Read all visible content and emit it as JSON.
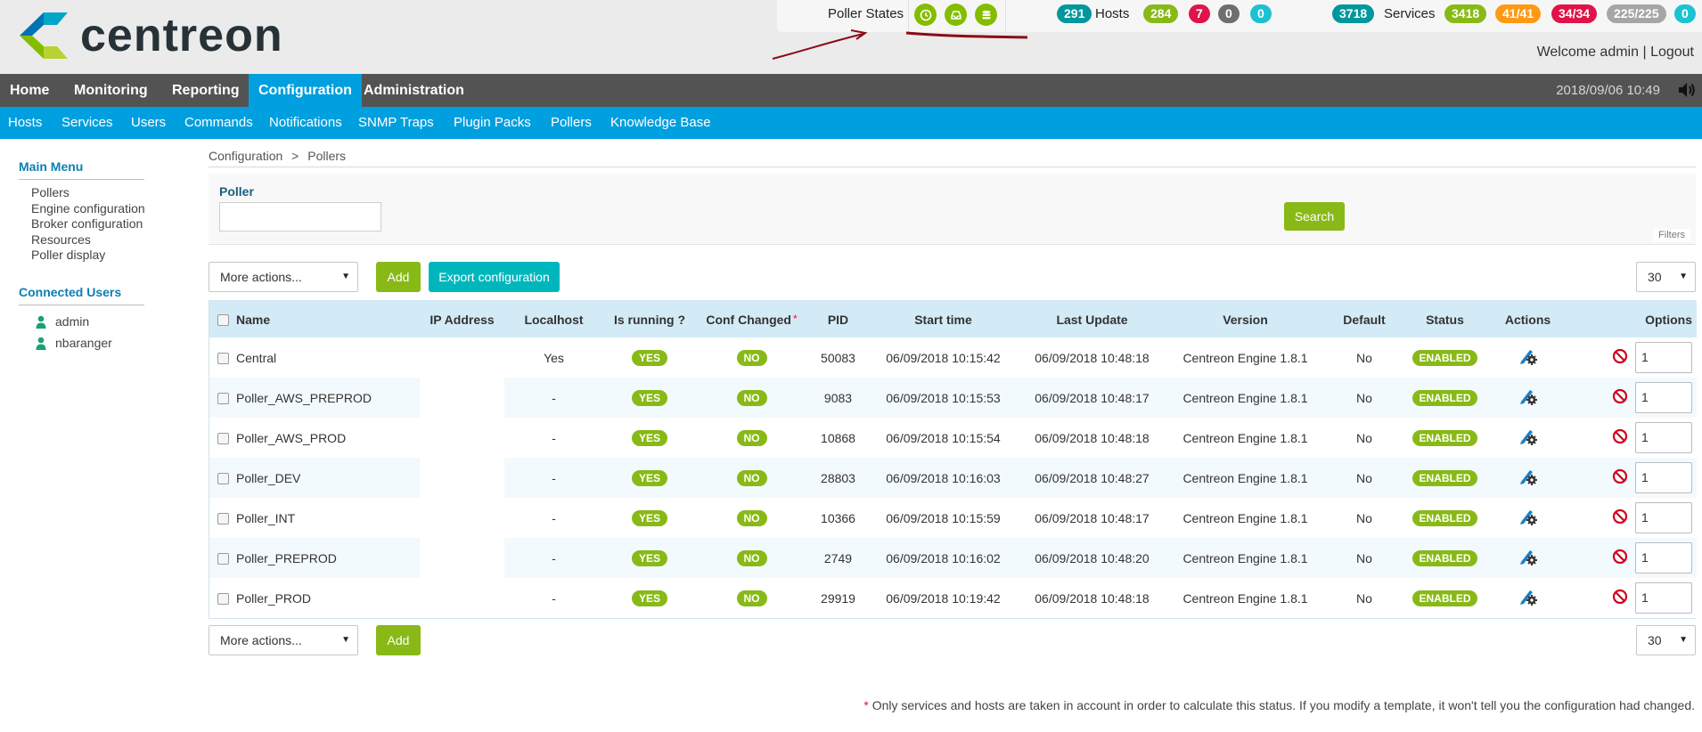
{
  "brand": {
    "name": "centreon"
  },
  "topbar": {
    "poller_states_label": "Poller States",
    "hosts": {
      "total": "291",
      "label": "Hosts",
      "up": "284",
      "down": "7",
      "unreachable": "0",
      "pending": "0"
    },
    "services": {
      "total": "3718",
      "label": "Services",
      "ok": "3418",
      "warning": "41/41",
      "critical": "34/34",
      "unknown": "225/225",
      "pending": "0"
    }
  },
  "user": {
    "welcome": "Welcome admin",
    "separator": "|",
    "logout": "Logout"
  },
  "main_nav": {
    "items": [
      "Home",
      "Monitoring",
      "Reporting",
      "Configuration",
      "Administration"
    ],
    "active": "Configuration",
    "datetime": "2018/09/06 10:49"
  },
  "sub_nav": {
    "items": [
      "Hosts",
      "Services",
      "Users",
      "Commands",
      "Notifications",
      "SNMP Traps",
      "Plugin Packs",
      "Pollers",
      "Knowledge Base"
    ]
  },
  "sidebar": {
    "main_menu_title": "Main Menu",
    "main_menu_items": [
      "Pollers",
      "Engine configuration",
      "Broker configuration",
      "Resources",
      "Poller display"
    ],
    "connected_users_title": "Connected Users",
    "connected_users": [
      "admin",
      "nbaranger"
    ]
  },
  "breadcrumb": {
    "parent": "Configuration",
    "separator": ">",
    "current": "Pollers"
  },
  "filter": {
    "label": "Poller",
    "value": "",
    "search_button": "Search",
    "filters_tag": "Filters"
  },
  "toolbar": {
    "more_actions": "More actions...",
    "add": "Add",
    "export": "Export configuration",
    "page_size": "30"
  },
  "table": {
    "columns": [
      "Name",
      "IP Address",
      "Localhost",
      "Is running ?",
      "Conf Changed",
      "PID",
      "Start time",
      "Last Update",
      "Version",
      "Default",
      "Status",
      "Actions",
      "Options"
    ],
    "conf_changed_marker": "*",
    "rows": [
      {
        "name": "Central",
        "ip": "",
        "localhost": "Yes",
        "running": "YES",
        "conf_changed": "NO",
        "pid": "50083",
        "start": "06/09/2018 10:15:42",
        "last_update": "06/09/2018 10:48:18",
        "version": "Centreon Engine 1.8.1",
        "default": "No",
        "status": "ENABLED",
        "option": "1"
      },
      {
        "name": "Poller_AWS_PREPROD",
        "ip": "",
        "localhost": "-",
        "running": "YES",
        "conf_changed": "NO",
        "pid": "9083",
        "start": "06/09/2018 10:15:53",
        "last_update": "06/09/2018 10:48:17",
        "version": "Centreon Engine 1.8.1",
        "default": "No",
        "status": "ENABLED",
        "option": "1"
      },
      {
        "name": "Poller_AWS_PROD",
        "ip": "",
        "localhost": "-",
        "running": "YES",
        "conf_changed": "NO",
        "pid": "10868",
        "start": "06/09/2018 10:15:54",
        "last_update": "06/09/2018 10:48:18",
        "version": "Centreon Engine 1.8.1",
        "default": "No",
        "status": "ENABLED",
        "option": "1"
      },
      {
        "name": "Poller_DEV",
        "ip": "",
        "localhost": "-",
        "running": "YES",
        "conf_changed": "NO",
        "pid": "28803",
        "start": "06/09/2018 10:16:03",
        "last_update": "06/09/2018 10:48:27",
        "version": "Centreon Engine 1.8.1",
        "default": "No",
        "status": "ENABLED",
        "option": "1"
      },
      {
        "name": "Poller_INT",
        "ip": "",
        "localhost": "-",
        "running": "YES",
        "conf_changed": "NO",
        "pid": "10366",
        "start": "06/09/2018 10:15:59",
        "last_update": "06/09/2018 10:48:17",
        "version": "Centreon Engine 1.8.1",
        "default": "No",
        "status": "ENABLED",
        "option": "1"
      },
      {
        "name": "Poller_PREPROD",
        "ip": "",
        "localhost": "-",
        "running": "YES",
        "conf_changed": "NO",
        "pid": "2749",
        "start": "06/09/2018 10:16:02",
        "last_update": "06/09/2018 10:48:20",
        "version": "Centreon Engine 1.8.1",
        "default": "No",
        "status": "ENABLED",
        "option": "1"
      },
      {
        "name": "Poller_PROD",
        "ip": "",
        "localhost": "-",
        "running": "YES",
        "conf_changed": "NO",
        "pid": "29919",
        "start": "06/09/2018 10:19:42",
        "last_update": "06/09/2018 10:48:18",
        "version": "Centreon Engine 1.8.1",
        "default": "No",
        "status": "ENABLED",
        "option": "1"
      }
    ]
  },
  "footnote": {
    "star": "*",
    "text": "Only services and hosts are taken in account in order to calculate this status. If you modify a template, it won't tell you the configuration had changed."
  },
  "icons": {
    "poller_states": [
      "clock-icon",
      "inbox-icon",
      "database-icon"
    ],
    "actions": "edit-gear-icon",
    "options": "disable-icon",
    "sound": "speaker-icon",
    "user": "user-icon"
  },
  "colors": {
    "primary_blue": "#009fdf",
    "nav_gray": "#535353",
    "green": "#88b917",
    "teal": "#00979d",
    "red": "#e0144a",
    "orange": "#ff9913",
    "cyan": "#1cc2d2"
  }
}
